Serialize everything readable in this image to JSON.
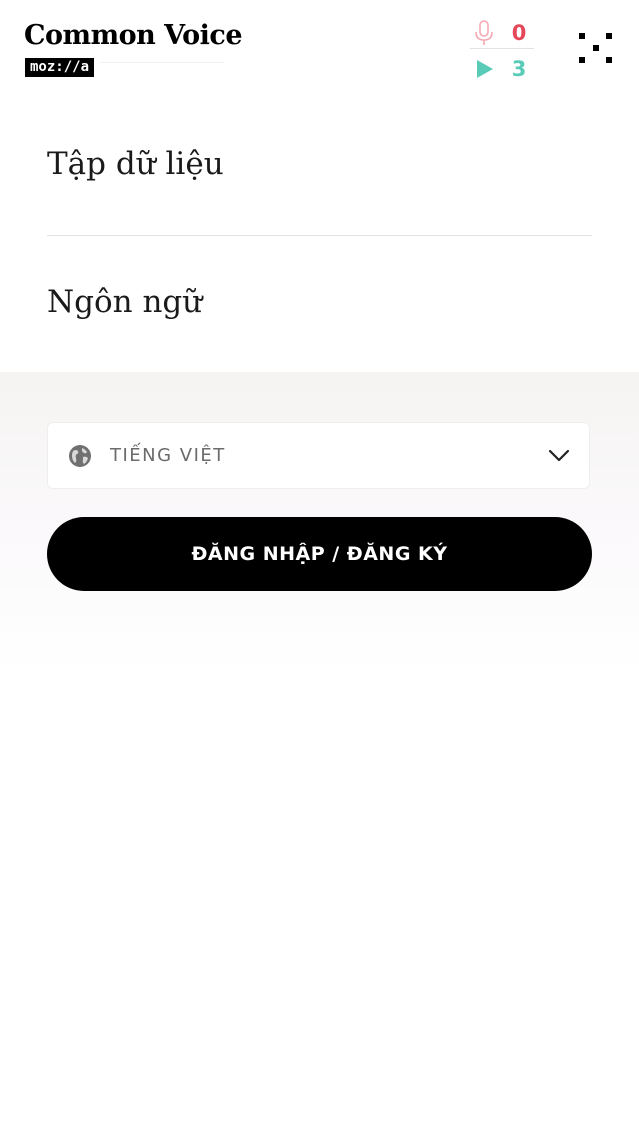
{
  "header": {
    "brand_title": "Common Voice",
    "brand_subtitle": "moz://a",
    "stats": {
      "recorded_count": "0",
      "validated_count": "3"
    }
  },
  "nav": {
    "items": [
      {
        "label": "Tập dữ liệu"
      },
      {
        "label": "Ngôn ngữ"
      }
    ]
  },
  "language_select": {
    "value": "TIẾNG VIỆT"
  },
  "login": {
    "label": "ĐĂNG NHẬP / ĐĂNG KÝ"
  },
  "colors": {
    "record_accent": "#e4465a",
    "listen_accent": "#59cbb7",
    "primary_button": "#000000"
  },
  "icons": {
    "record": "microphone-icon",
    "listen": "play-icon",
    "menu": "menu-dots-icon",
    "language": "globe-icon",
    "dropdown": "chevron-down-icon"
  }
}
